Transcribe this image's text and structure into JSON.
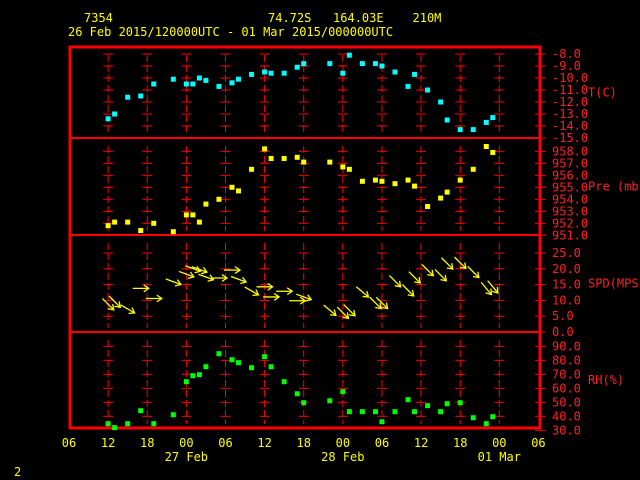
{
  "header": {
    "station": "7354",
    "location": "74.72S   164.03E    210M",
    "period": "26 Feb 2015/120000UTC - 01 Mar 2015/000000UTC"
  },
  "footer": {
    "page": "2"
  },
  "colors": {
    "frame": "#ff0000",
    "temp": "#00ffff",
    "pressure": "#ffff00",
    "wind": "#ffff00",
    "rh": "#00ff00",
    "text": "#ffff00"
  },
  "chart_data": {
    "type": "scatter",
    "x_units": "hours since 26 Feb 2015 06UTC",
    "x": [
      6,
      7,
      9,
      11,
      13,
      16,
      18,
      19,
      20,
      21,
      23,
      25,
      26,
      28,
      30,
      31,
      33,
      35,
      36,
      40,
      42,
      43,
      45,
      47,
      48,
      50,
      52,
      53,
      55,
      57,
      58,
      60,
      62,
      64,
      65
    ],
    "xlim": [
      0,
      72
    ],
    "x_tick_labels": [
      "06",
      "12",
      "18",
      "00",
      "06",
      "12",
      "18",
      "00",
      "06",
      "12",
      "18",
      "00",
      "06"
    ],
    "date_labels": [
      {
        "label": "27 Feb",
        "hour": 18
      },
      {
        "label": "28 Feb",
        "hour": 42
      },
      {
        "label": "01 Mar",
        "hour": 66
      }
    ],
    "panels": [
      {
        "name": "T(C)",
        "ylim": [
          -15,
          -8
        ],
        "tick_labels": [
          "-8.0",
          "-9.0",
          "-10.0",
          "-11.0",
          "-12.0",
          "-13.0",
          "-14.0",
          "-15.0"
        ],
        "values": [
          -13.4,
          -13.0,
          -11.6,
          -11.5,
          -10.5,
          -10.1,
          -10.5,
          -10.5,
          -10.0,
          -10.2,
          -10.7,
          -10.4,
          -10.1,
          -9.7,
          -9.5,
          -9.6,
          -9.6,
          -9.1,
          -8.8,
          -8.8,
          -9.6,
          -8.1,
          -8.8,
          -8.8,
          -9.0,
          -9.5,
          -10.7,
          -9.7,
          -11.0,
          -12.0,
          -13.5,
          -14.3,
          -14.3,
          -13.7,
          -13.3
        ]
      },
      {
        "name": "Pre (mb)",
        "ylim": [
          951,
          958
        ],
        "tick_labels": [
          "958.0",
          "957.0",
          "956.0",
          "955.0",
          "954.0",
          "953.0",
          "952.0",
          "951.0"
        ],
        "values": [
          951.8,
          952.1,
          952.1,
          951.4,
          952.0,
          951.3,
          952.7,
          952.7,
          952.1,
          953.6,
          954.0,
          955.0,
          954.7,
          956.5,
          958.2,
          957.4,
          957.4,
          957.5,
          957.1,
          957.1,
          956.7,
          956.5,
          955.5,
          955.6,
          955.5,
          955.3,
          955.6,
          955.1,
          953.4,
          954.1,
          954.6,
          955.6,
          956.5,
          958.4,
          957.9
        ]
      },
      {
        "name": "SPD(MPS)",
        "ylim": [
          0,
          25
        ],
        "tick_labels": [
          "25.0",
          "20.0",
          "15.0",
          "10.0",
          "5.0",
          "0.0"
        ],
        "values": [
          8.8,
          9.6,
          7.3,
          13.8,
          10.6,
          15.9,
          18.3,
          20.1,
          19.8,
          17.4,
          17.1,
          19.6,
          16.7,
          13.0,
          14.3,
          11.1,
          12.9,
          9.9,
          11.1,
          6.9,
          6.1,
          6.9,
          12.7,
          9.2,
          9.2,
          16.1,
          13.2,
          17.3,
          19.6,
          18.0,
          21.7,
          21.9,
          19.0,
          13.8,
          14.3
        ],
        "direction_deg": [
          315,
          315,
          300,
          270,
          270,
          290,
          290,
          290,
          290,
          290,
          270,
          270,
          290,
          300,
          270,
          270,
          270,
          270,
          290,
          310,
          315,
          315,
          310,
          315,
          315,
          315,
          315,
          315,
          315,
          315,
          315,
          315,
          315,
          320,
          320
        ]
      },
      {
        "name": "RH(%)",
        "ylim": [
          30,
          90
        ],
        "tick_labels": [
          "90.0",
          "80.0",
          "70.0",
          "60.0",
          "50.0",
          "40.0",
          "30.0"
        ],
        "values": [
          34.7,
          31.9,
          34.7,
          44.0,
          34.7,
          41.1,
          64.7,
          69.0,
          69.7,
          75.4,
          84.7,
          80.4,
          78.3,
          74.7,
          82.6,
          75.4,
          64.7,
          56.1,
          49.7,
          51.1,
          57.6,
          43.3,
          43.3,
          43.3,
          36.1,
          43.3,
          51.9,
          43.3,
          47.6,
          43.3,
          49.0,
          49.7,
          39.0,
          34.7,
          39.7
        ]
      }
    ]
  }
}
